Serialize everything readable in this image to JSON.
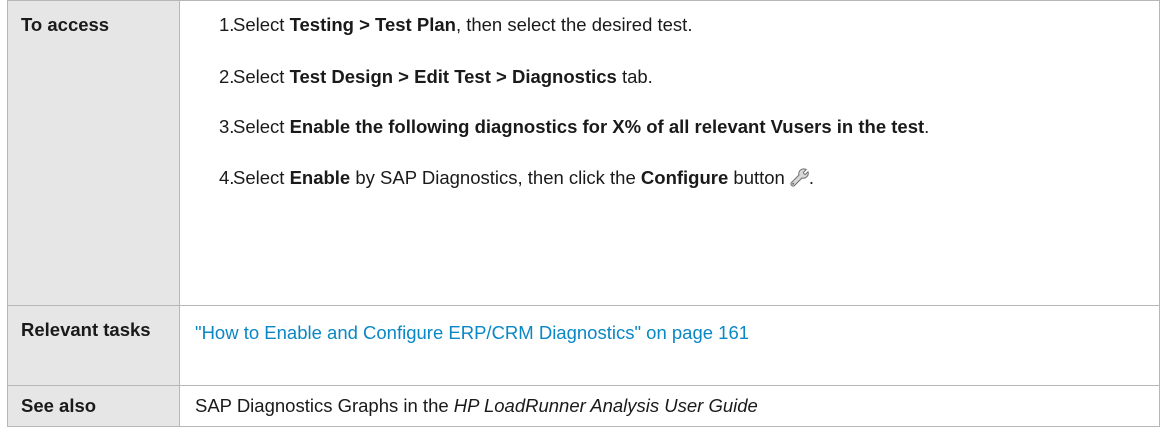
{
  "rows": [
    {
      "label": "To access",
      "steps": [
        {
          "num": "1.",
          "pre": "Select ",
          "bold": "Testing > Test Plan",
          "post": ", then select the desired test."
        },
        {
          "num": "2.",
          "pre": "Select ",
          "bold": "Test Design > Edit Test > Diagnostics",
          "post": " tab."
        },
        {
          "num": "3.",
          "pre": "Select ",
          "bold": "Enable the following diagnostics for X% of all relevant Vusers in the test",
          "post": "."
        },
        {
          "num": "4.",
          "pre": "Select ",
          "bold": "Enable",
          "mid": " by SAP Diagnostics, then click the ",
          "bold2": "Configure",
          "post": " button",
          "end": ".",
          "icon": "wrench-icon"
        }
      ]
    },
    {
      "label": "Relevant tasks",
      "link_text": "\"How to Enable and Configure ERP/CRM Diagnostics\" on page 161"
    },
    {
      "label": "See also",
      "pre": "SAP Diagnostics Graphs in the ",
      "italic": "HP LoadRunner Analysis User Guide"
    }
  ],
  "colors": {
    "label_bg": "#e6e6e6",
    "link": "#0a87c5",
    "border": "#b7b7b7"
  }
}
